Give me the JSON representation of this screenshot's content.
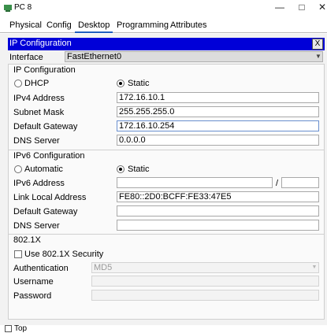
{
  "window": {
    "title": "PC 8",
    "min": "—",
    "max": "□",
    "close": "✕"
  },
  "tabs": [
    {
      "label": "Physical"
    },
    {
      "label": "Config"
    },
    {
      "label": "Desktop"
    },
    {
      "label": "Programming"
    },
    {
      "label": "Attributes"
    }
  ],
  "active_tab": "Desktop",
  "ip_config": {
    "header_title": "IP Configuration",
    "close_label": "X",
    "interface_label": "Interface",
    "interface_value": "FastEthernet0",
    "ipv4_section": {
      "title": "IP Configuration",
      "dhcp_label": "DHCP",
      "static_label": "Static",
      "selected": "Static",
      "ipv4_label": "IPv4 Address",
      "ipv4_value": "172.16.10.1",
      "mask_label": "Subnet Mask",
      "mask_value": "255.255.255.0",
      "gateway_label": "Default Gateway",
      "gateway_value": "172.16.10.254",
      "dns_label": "DNS Server",
      "dns_value": "0.0.0.0"
    },
    "ipv6_section": {
      "title": "IPv6 Configuration",
      "auto_label": "Automatic",
      "static_label": "Static",
      "selected": "Static",
      "ipv6_label": "IPv6 Address",
      "ipv6_value": "",
      "prefix_sep": "/",
      "prefix_value": "",
      "linklocal_label": "Link Local Address",
      "linklocal_value": "FE80::2D0:BCFF:FE33:47E5",
      "gateway_label": "Default Gateway",
      "gateway_value": "",
      "dns_label": "DNS Server",
      "dns_value": ""
    },
    "dot1x_section": {
      "title": "802.1X",
      "use_label": "Use 802.1X Security",
      "use_checked": false,
      "auth_label": "Authentication",
      "auth_value": "MD5",
      "username_label": "Username",
      "username_value": "",
      "password_label": "Password",
      "password_value": ""
    }
  },
  "footer": {
    "top_label": "Top",
    "top_checked": false
  },
  "colors": {
    "header_bg": "#0000d8",
    "active_tab_underline": "#1f5fbf"
  }
}
